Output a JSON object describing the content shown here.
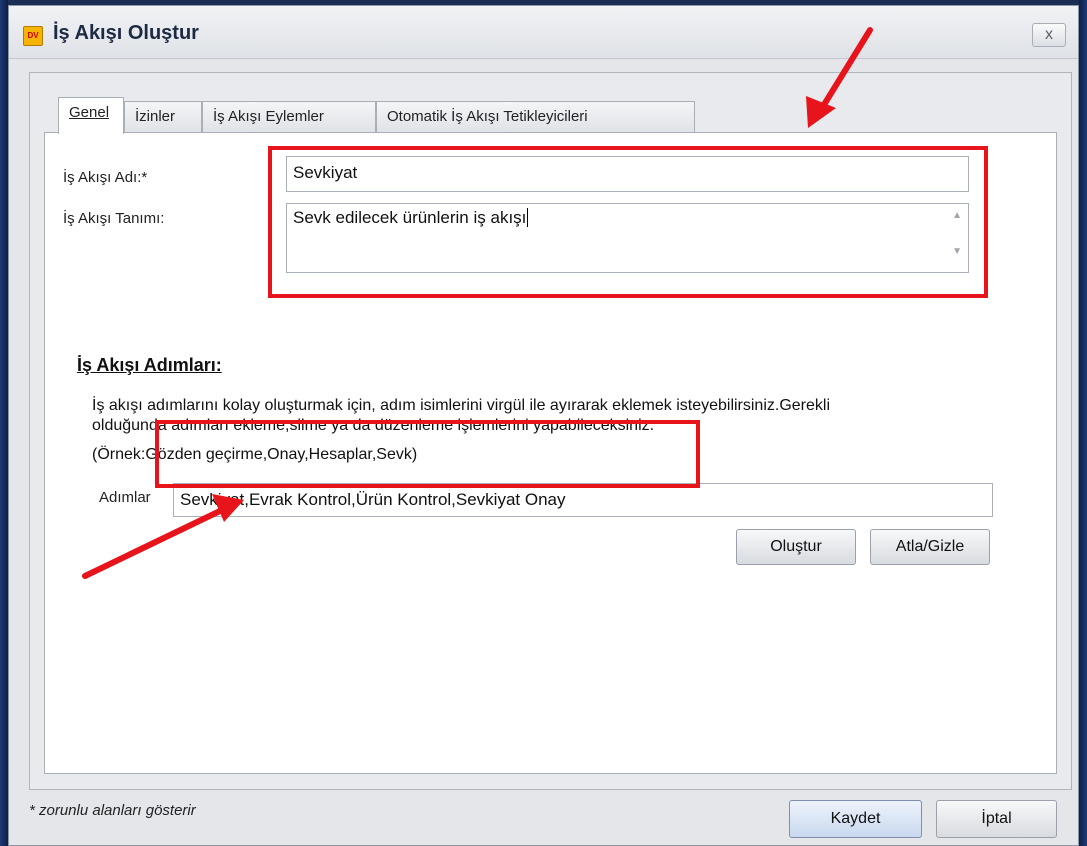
{
  "window": {
    "title": "İş Akışı Oluştur",
    "app_icon_text": "DV",
    "close_label": "x"
  },
  "tabs": [
    {
      "label": "Genel"
    },
    {
      "label": "İzinler"
    },
    {
      "label": "İş Akışı Eylemler"
    },
    {
      "label": "Otomatik İş Akışı Tetikleyicileri"
    }
  ],
  "form": {
    "name_label": "İş Akışı Adı:*",
    "name_value": "Sevkiyat",
    "description_label": "İş Akışı Tanımı:",
    "description_value": "Sevk edilecek ürünlerin iş akışı",
    "steps_section_title": "İş Akışı Adımları:",
    "help_line1": "İş akışı adımlarını kolay oluşturmak için, adım isimlerini virgül ile ayırarak eklemek isteyebilirsiniz.Gerekli",
    "help_line2": "olduğunda adımları ekleme,silme ya da düzenleme işlemlerini yapabileceksiniz.",
    "example": "(Örnek:Gözden geçirme,Onay,Hesaplar,Sevk)",
    "steps_label": "Adımlar",
    "steps_value": "Sevkiyat,Evrak Kontrol,Ürün Kontrol,Sevkiyat Onay",
    "create_button": "Oluştur",
    "skip_button": "Atla/Gizle"
  },
  "footer": {
    "required_note": "* zorunlu alanları gösterir",
    "save_button": "Kaydet",
    "cancel_button": "İptal"
  },
  "colors": {
    "annotation": "#e8141c"
  }
}
